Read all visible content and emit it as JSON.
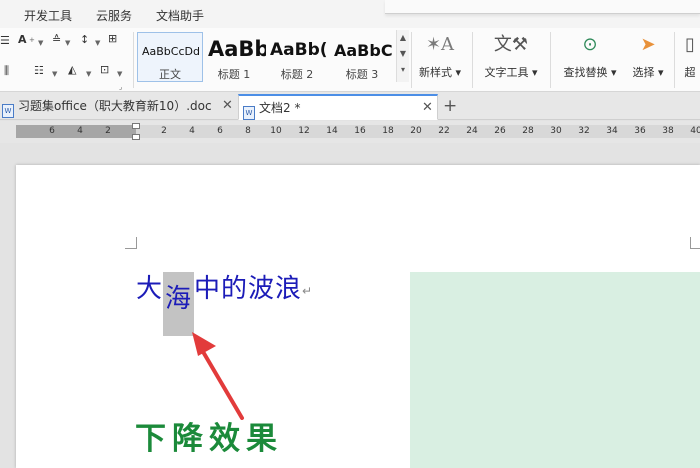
{
  "menu": {
    "items": [
      "开发工具",
      "云服务",
      "文档助手"
    ]
  },
  "ribbon": {
    "styles": [
      {
        "sample": "AaBbCcDd",
        "name": "正文"
      },
      {
        "sample": "AaBb",
        "name": "标题 1"
      },
      {
        "sample": "AaBb(",
        "name": "标题 2"
      },
      {
        "sample": "AaBbC",
        "name": "标题 3"
      }
    ],
    "new_style_label": "新样式",
    "text_tools_label": "文字工具",
    "find_replace_label": "查找替换",
    "select_label": "选择",
    "overflow_label": "超",
    "font_icons": [
      "A",
      "A",
      "Ai"
    ]
  },
  "tabs": [
    {
      "label": "习题集office（职大教育新10）.doc",
      "active": false
    },
    {
      "label": "文档2 *",
      "active": true
    }
  ],
  "ruler": {
    "numbers": [
      "6",
      "4",
      "2",
      "2",
      "4",
      "6",
      "8",
      "10",
      "12",
      "14",
      "16",
      "18",
      "20",
      "22",
      "24",
      "26",
      "28",
      "30",
      "32",
      "34",
      "36",
      "38",
      "40"
    ]
  },
  "document": {
    "line_before": "大",
    "highlighted_char": "海",
    "line_after": "中的波浪",
    "paragraph_mark": "↵",
    "caption": "下降效果"
  },
  "colors": {
    "accent": "#4c8ee6",
    "doc_text": "#1c1cb8",
    "caption": "#1b8a3a",
    "arrow": "#e23b3b",
    "green_block": "#d9efe2"
  }
}
